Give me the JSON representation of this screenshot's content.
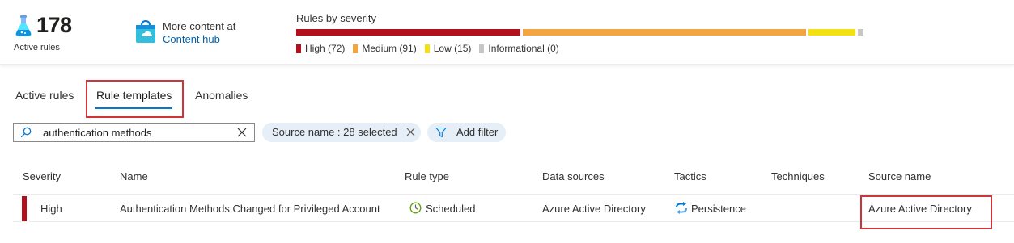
{
  "summary": {
    "active_count": "178",
    "active_label": "Active rules",
    "content_line1": "More content at",
    "content_line2": "Content hub",
    "severity_title": "Rules by severity",
    "severity": [
      {
        "label": "High (72)",
        "count": 72,
        "color": "#b1101c"
      },
      {
        "label": "Medium (91)",
        "count": 91,
        "color": "#f2a541"
      },
      {
        "label": "Low (15)",
        "count": 15,
        "color": "#f4e114"
      },
      {
        "label": "Informational (0)",
        "count": 0,
        "color": "#c8c6c4"
      }
    ]
  },
  "tabs": [
    {
      "label": "Active rules",
      "active": false
    },
    {
      "label": "Rule templates",
      "active": true
    },
    {
      "label": "Anomalies",
      "active": false
    }
  ],
  "filters": {
    "search_value": "authentication methods",
    "source_pill": "Source name : 28 selected",
    "add_filter": "Add filter"
  },
  "table": {
    "columns": [
      "Severity",
      "Name",
      "Rule type",
      "Data sources",
      "Tactics",
      "Techniques",
      "Source name"
    ],
    "rows": [
      {
        "severity": "High",
        "name": "Authentication Methods Changed for Privileged Account",
        "rule_type": "Scheduled",
        "data_sources": "Azure Active Directory",
        "tactics": "Persistence",
        "techniques": "",
        "source_name": "Azure Active Directory"
      }
    ]
  },
  "icons": {
    "active": "flask-icon",
    "content_hub": "shopping-bag-icon",
    "search": "search-icon",
    "clear": "close-icon",
    "filter": "funnel-icon",
    "rule_type": "clock-icon",
    "tactic": "persistence-cycle-icon"
  }
}
